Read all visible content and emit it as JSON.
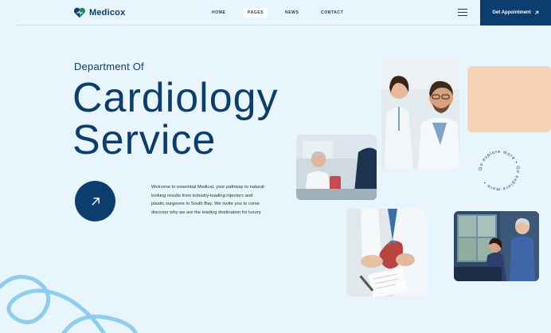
{
  "brand": {
    "name": "Medicox"
  },
  "nav": {
    "items": [
      {
        "label": "HOME"
      },
      {
        "label": "PAGES",
        "active": true
      },
      {
        "label": "NEWS"
      },
      {
        "label": "CONTACT"
      }
    ]
  },
  "header": {
    "cta_label": "Get Appointment",
    "cta_icon": "arrow-up-right-icon"
  },
  "hero": {
    "subtitle": "Department Of",
    "title_line1": "Cardiology",
    "title_line2": "Service",
    "description": "Welcome to esseintial Medical, your pathway to natural-looking results from industry-leading injectors and plastic surgeons in South Bay. We invite you to come discover why we are the leading destination for luxury.",
    "button_icon": "arrow-up-right-icon"
  },
  "badge": {
    "circular_text": "Go explore more • Go explore more • "
  },
  "colors": {
    "navy": "#0b3d6e",
    "background": "#e8f5fc",
    "peach": "#f8d2b4",
    "swirl": "#8ccdf0"
  }
}
